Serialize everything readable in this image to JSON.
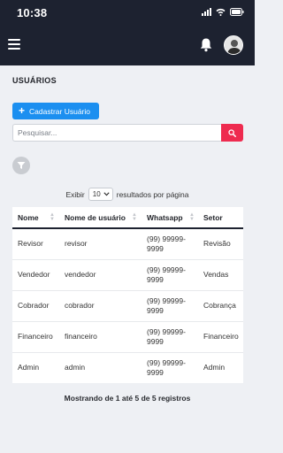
{
  "status_bar": {
    "time": "10:38"
  },
  "page": {
    "title": "USUÁRIOS"
  },
  "actions": {
    "add_label": "Cadastrar Usuário"
  },
  "search": {
    "placeholder": "Pesquisar..."
  },
  "length": {
    "prefix": "Exibir",
    "value": "10",
    "suffix": "resultados por página"
  },
  "table": {
    "columns": [
      "Nome",
      "Nome de usuário",
      "Whatsapp",
      "Setor"
    ],
    "rows": [
      [
        "Revisor",
        "revisor",
        "(99) 99999-9999",
        "Revisão"
      ],
      [
        "Vendedor",
        "vendedor",
        "(99) 99999-9999",
        "Vendas"
      ],
      [
        "Cobrador",
        "cobrador",
        "(99) 99999-9999",
        "Cobrança"
      ],
      [
        "Financeiro",
        "financeiro",
        "(99) 99999-9999",
        "Financeiro"
      ],
      [
        "Admin",
        "admin",
        "(99) 99999-9999",
        "Admin"
      ]
    ]
  },
  "info": {
    "text": "Mostrando de 1 até 5 de 5 registros"
  },
  "colors": {
    "header_bg": "#1d2230",
    "primary": "#1b8ff0",
    "danger": "#ee2b4f"
  }
}
